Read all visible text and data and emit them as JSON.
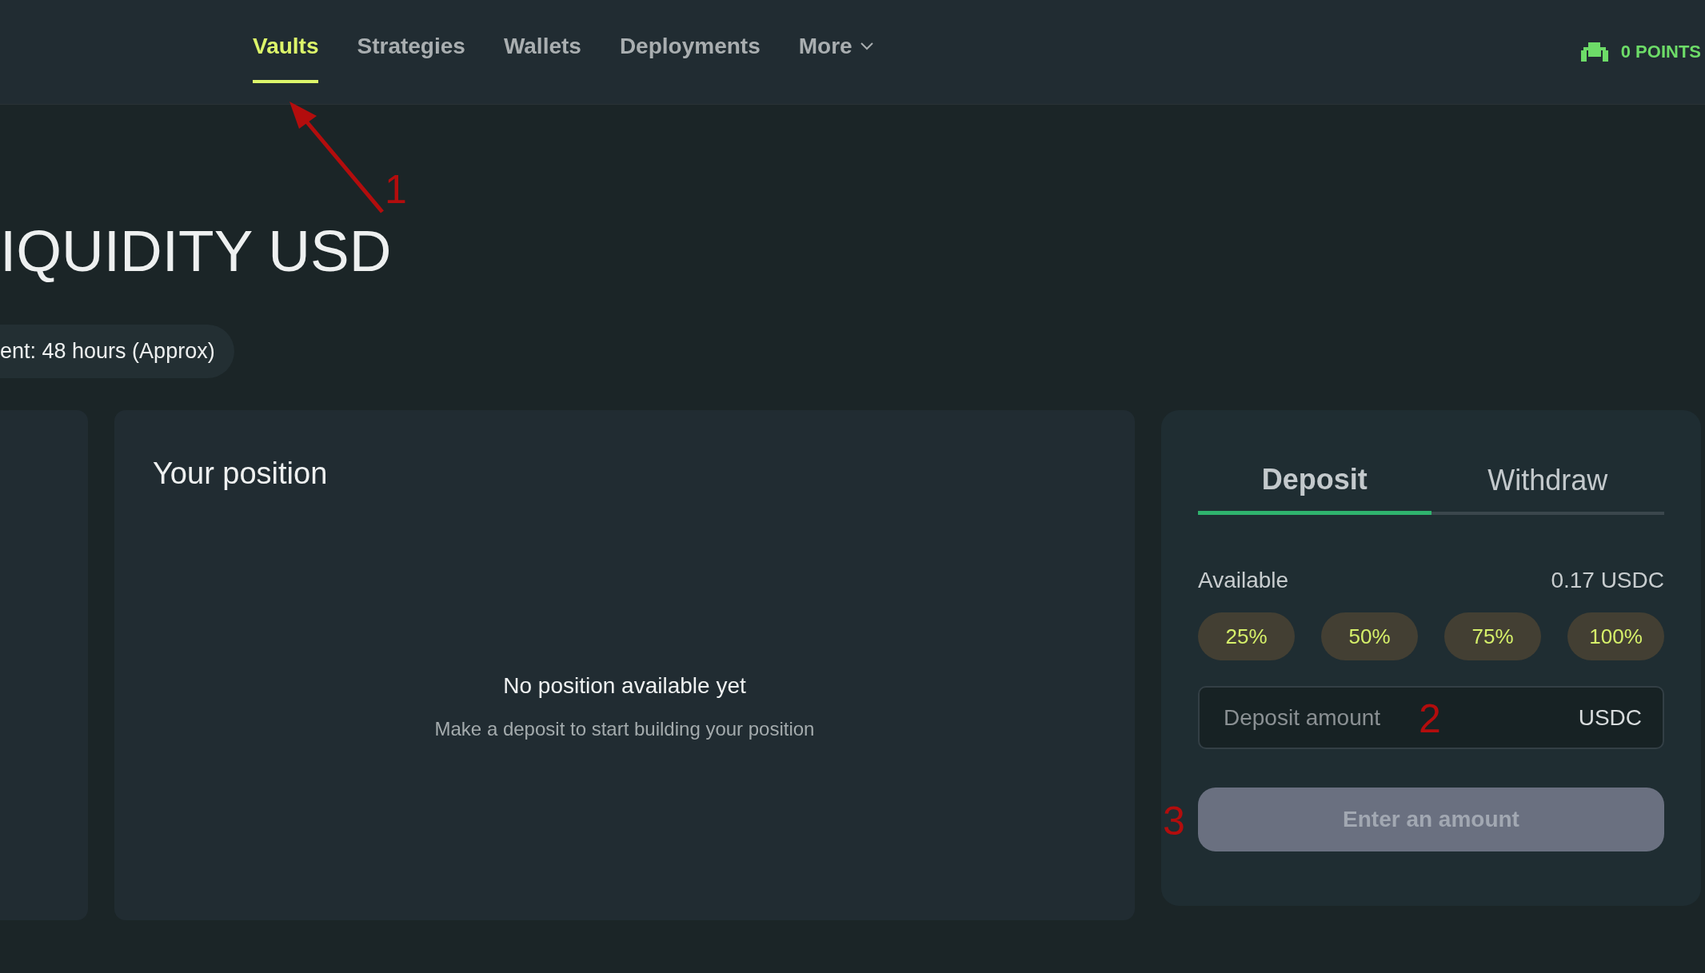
{
  "nav": {
    "items": [
      {
        "label": "Vaults",
        "selected": true,
        "kind": "link"
      },
      {
        "label": "Strategies",
        "selected": false,
        "kind": "link"
      },
      {
        "label": "Wallets",
        "selected": false,
        "kind": "link"
      },
      {
        "label": "Deployments",
        "selected": false,
        "kind": "link"
      },
      {
        "label": "More",
        "selected": false,
        "kind": "menu"
      }
    ],
    "points": "0 POINTS"
  },
  "vault": {
    "title": "IQUIDITY USD",
    "settlement": "ent: 48 hours (Approx)"
  },
  "position": {
    "title": "Your position",
    "empty_title": "No position available yet",
    "empty_text": "Make a deposit to start building your position"
  },
  "trade": {
    "tabs": [
      {
        "label": "Deposit",
        "selected": true
      },
      {
        "label": "Withdraw",
        "selected": false
      }
    ],
    "available_label": "Available",
    "available_value": "0.17 USDC",
    "percent_buttons": [
      "25%",
      "50%",
      "75%",
      "100%"
    ],
    "amount_field": {
      "placeholder": "Deposit amount",
      "unit": "USDC"
    },
    "submit": {
      "label": "Enter an amount",
      "disabled": true
    }
  },
  "annotations": [
    {
      "label": "1",
      "kind": "arrow"
    },
    {
      "label": "2",
      "kind": "number"
    },
    {
      "label": "3",
      "kind": "number"
    }
  ]
}
